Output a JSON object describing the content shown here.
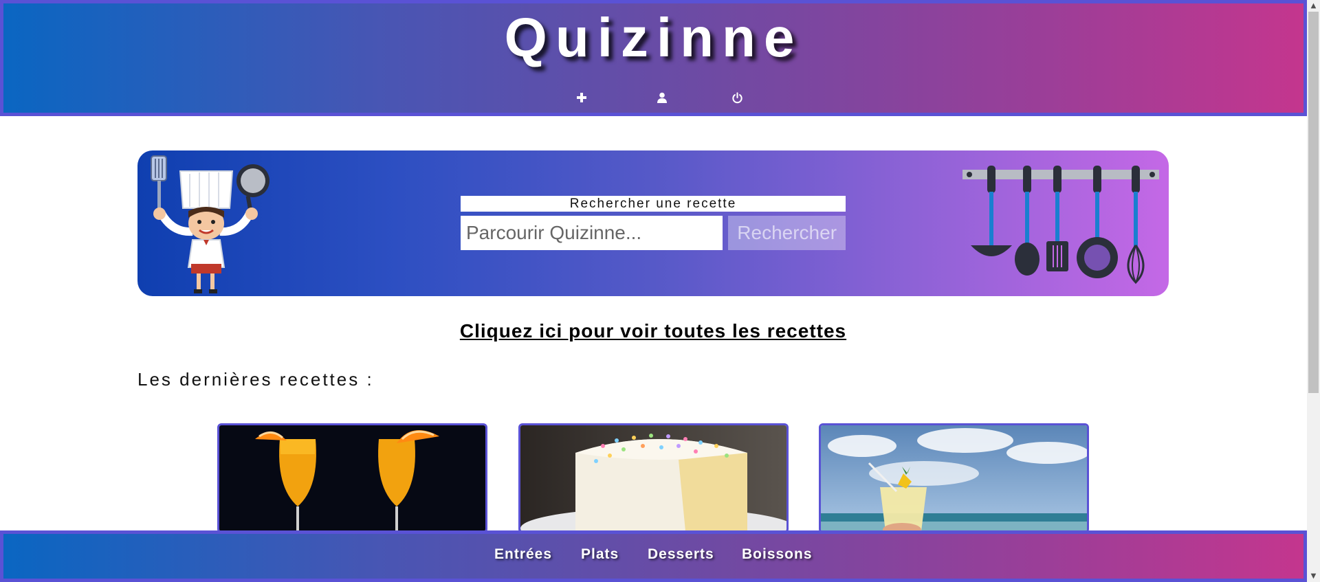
{
  "header": {
    "title": "Quizinne",
    "icons": [
      {
        "name": "plus-icon",
        "label": "+"
      },
      {
        "name": "user-icon",
        "label": "user"
      },
      {
        "name": "power-icon",
        "label": "power"
      }
    ]
  },
  "search": {
    "label": "Rechercher une recette",
    "placeholder": "Parcourir Quizinne...",
    "button": "Rechercher"
  },
  "main": {
    "all_recipes_link": "Cliquez ici pour voir toutes les recettes",
    "latest_heading": "Les dernières recettes :"
  },
  "cards": [
    {
      "image": "orange-cocktail-image"
    },
    {
      "image": "sprinkle-cake-image"
    },
    {
      "image": "beach-drink-image"
    }
  ],
  "footer_nav": {
    "items": [
      "Entrées",
      "Plats",
      "Desserts",
      "Boissons"
    ]
  },
  "colors": {
    "accent_border": "#5a52d5",
    "gradient_start": "#0a66c2",
    "gradient_end": "#c4368e"
  }
}
